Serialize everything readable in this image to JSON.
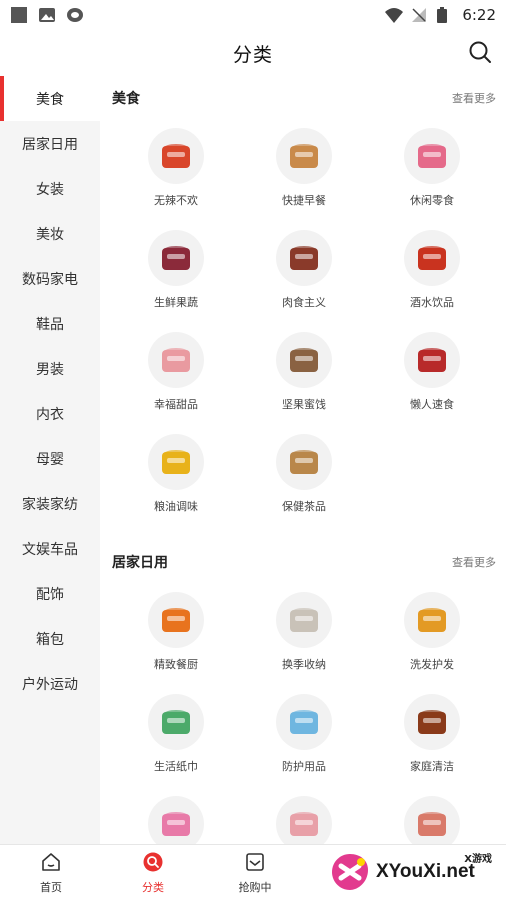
{
  "status_bar": {
    "time": "6:22"
  },
  "header": {
    "title": "分类",
    "search_icon": "search-icon"
  },
  "sidebar": {
    "items": [
      {
        "label": "美食",
        "active": true
      },
      {
        "label": "居家日用",
        "active": false
      },
      {
        "label": "女装",
        "active": false
      },
      {
        "label": "美妆",
        "active": false
      },
      {
        "label": "数码家电",
        "active": false
      },
      {
        "label": "鞋品",
        "active": false
      },
      {
        "label": "男装",
        "active": false
      },
      {
        "label": "内衣",
        "active": false
      },
      {
        "label": "母婴",
        "active": false
      },
      {
        "label": "家装家纺",
        "active": false
      },
      {
        "label": "文娱车品",
        "active": false
      },
      {
        "label": "配饰",
        "active": false
      },
      {
        "label": "箱包",
        "active": false
      },
      {
        "label": "户外运动",
        "active": false
      }
    ]
  },
  "sections": [
    {
      "title": "美食",
      "more": "查看更多",
      "items": [
        {
          "label": "无辣不欢",
          "color": "#d9462b"
        },
        {
          "label": "快捷早餐",
          "color": "#c98a4a"
        },
        {
          "label": "休闲零食",
          "color": "#e56a8a"
        },
        {
          "label": "生鲜果蔬",
          "color": "#8b2a3a"
        },
        {
          "label": "肉食主义",
          "color": "#8a3a2a"
        },
        {
          "label": "酒水饮品",
          "color": "#c9331f"
        },
        {
          "label": "幸福甜品",
          "color": "#e99aa0"
        },
        {
          "label": "坚果蜜饯",
          "color": "#8a6242"
        },
        {
          "label": "懒人速食",
          "color": "#b82a2a"
        },
        {
          "label": "粮油调味",
          "color": "#e8b21a"
        },
        {
          "label": "保健茶品",
          "color": "#b9874a"
        }
      ]
    },
    {
      "title": "居家日用",
      "more": "查看更多",
      "items": [
        {
          "label": "精致餐厨",
          "color": "#e8731e"
        },
        {
          "label": "换季收纳",
          "color": "#c9c2b8"
        },
        {
          "label": "洗发护发",
          "color": "#e39a24"
        },
        {
          "label": "生活纸巾",
          "color": "#4caa6a"
        },
        {
          "label": "防护用品",
          "color": "#6fb6e0"
        },
        {
          "label": "家庭清洁",
          "color": "#8a3a1a"
        },
        {
          "label": "",
          "color": "#e87aa8"
        },
        {
          "label": "",
          "color": "#e8a0a8"
        },
        {
          "label": "",
          "color": "#d97a6a"
        }
      ]
    }
  ],
  "bottom_nav": [
    {
      "label": "首页",
      "icon": "home-icon",
      "active": false
    },
    {
      "label": "分类",
      "icon": "category-icon",
      "active": true
    },
    {
      "label": "抢购中",
      "icon": "flash-sale-icon",
      "active": false
    }
  ],
  "watermark": {
    "text": "XYouXi.net",
    "tag": "X游戏"
  },
  "colors": {
    "accent": "#e8312f",
    "sidebar_bg": "#f5f5f5"
  }
}
